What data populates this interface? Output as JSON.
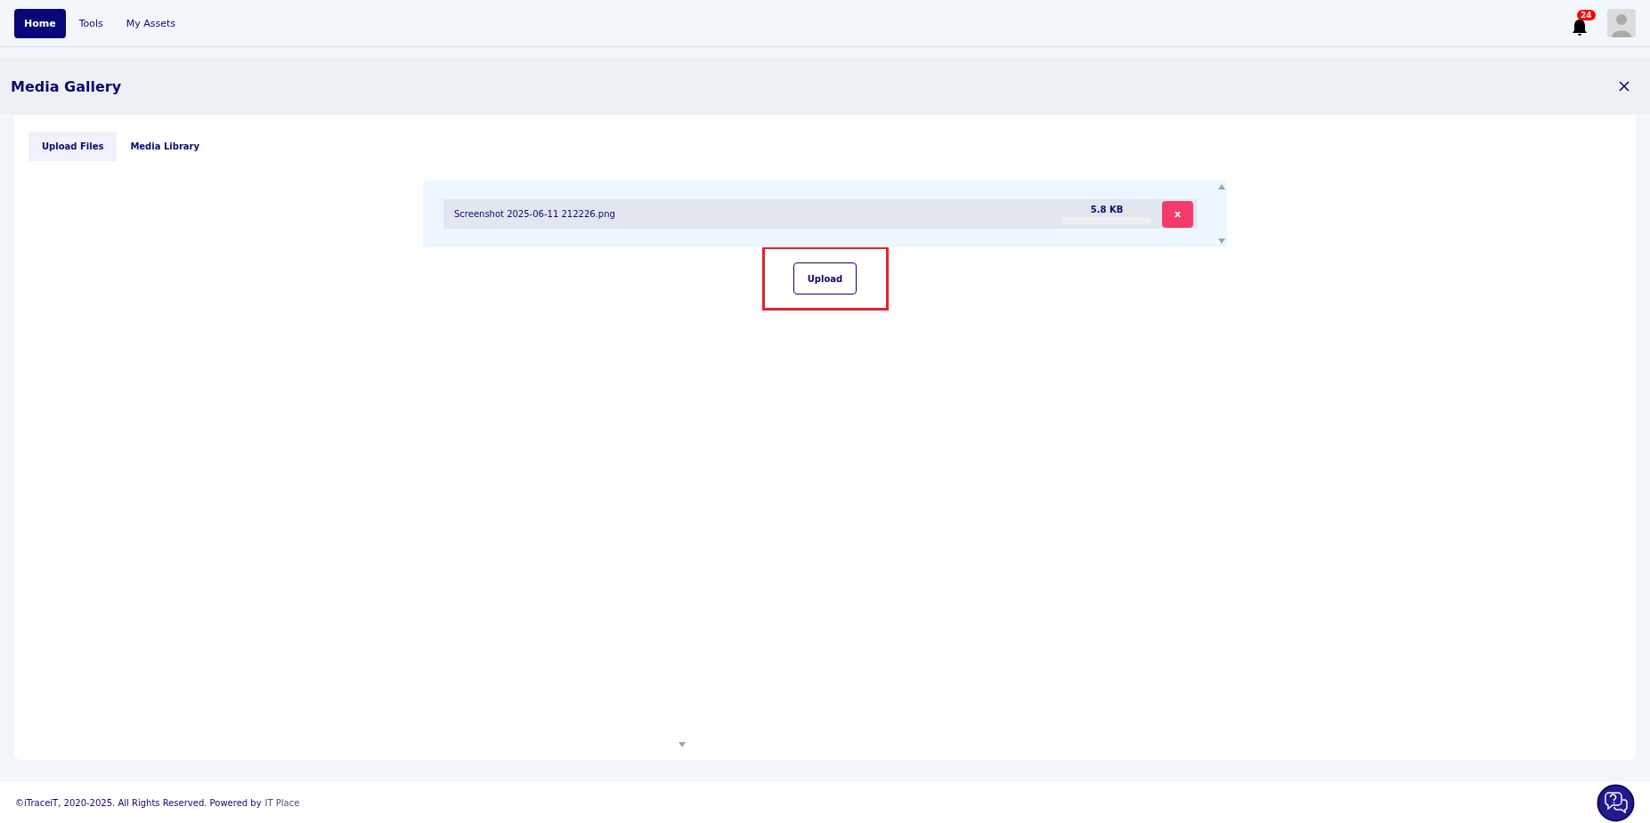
{
  "nav": {
    "items": [
      {
        "label": "Home",
        "selected": true
      },
      {
        "label": "Tools",
        "selected": false
      },
      {
        "label": "My Assets",
        "selected": false
      }
    ],
    "notifications": {
      "count": "24"
    }
  },
  "header": {
    "title": "Media Gallery"
  },
  "tabs": [
    {
      "label": "Upload Files",
      "selected": true
    },
    {
      "label": "Media Library",
      "selected": false
    }
  ],
  "files": [
    {
      "name": "Screenshot 2025-06-11 212226.png",
      "size": "5.8 KB",
      "level": 0,
      "remove": "x"
    }
  ],
  "upload_button": {
    "label": "Upload",
    "highlighted": true
  },
  "footer": {
    "text": "©iTraceiT, 2020-2025. All Rights Reserved. Powered by",
    "link": "IT Place"
  }
}
